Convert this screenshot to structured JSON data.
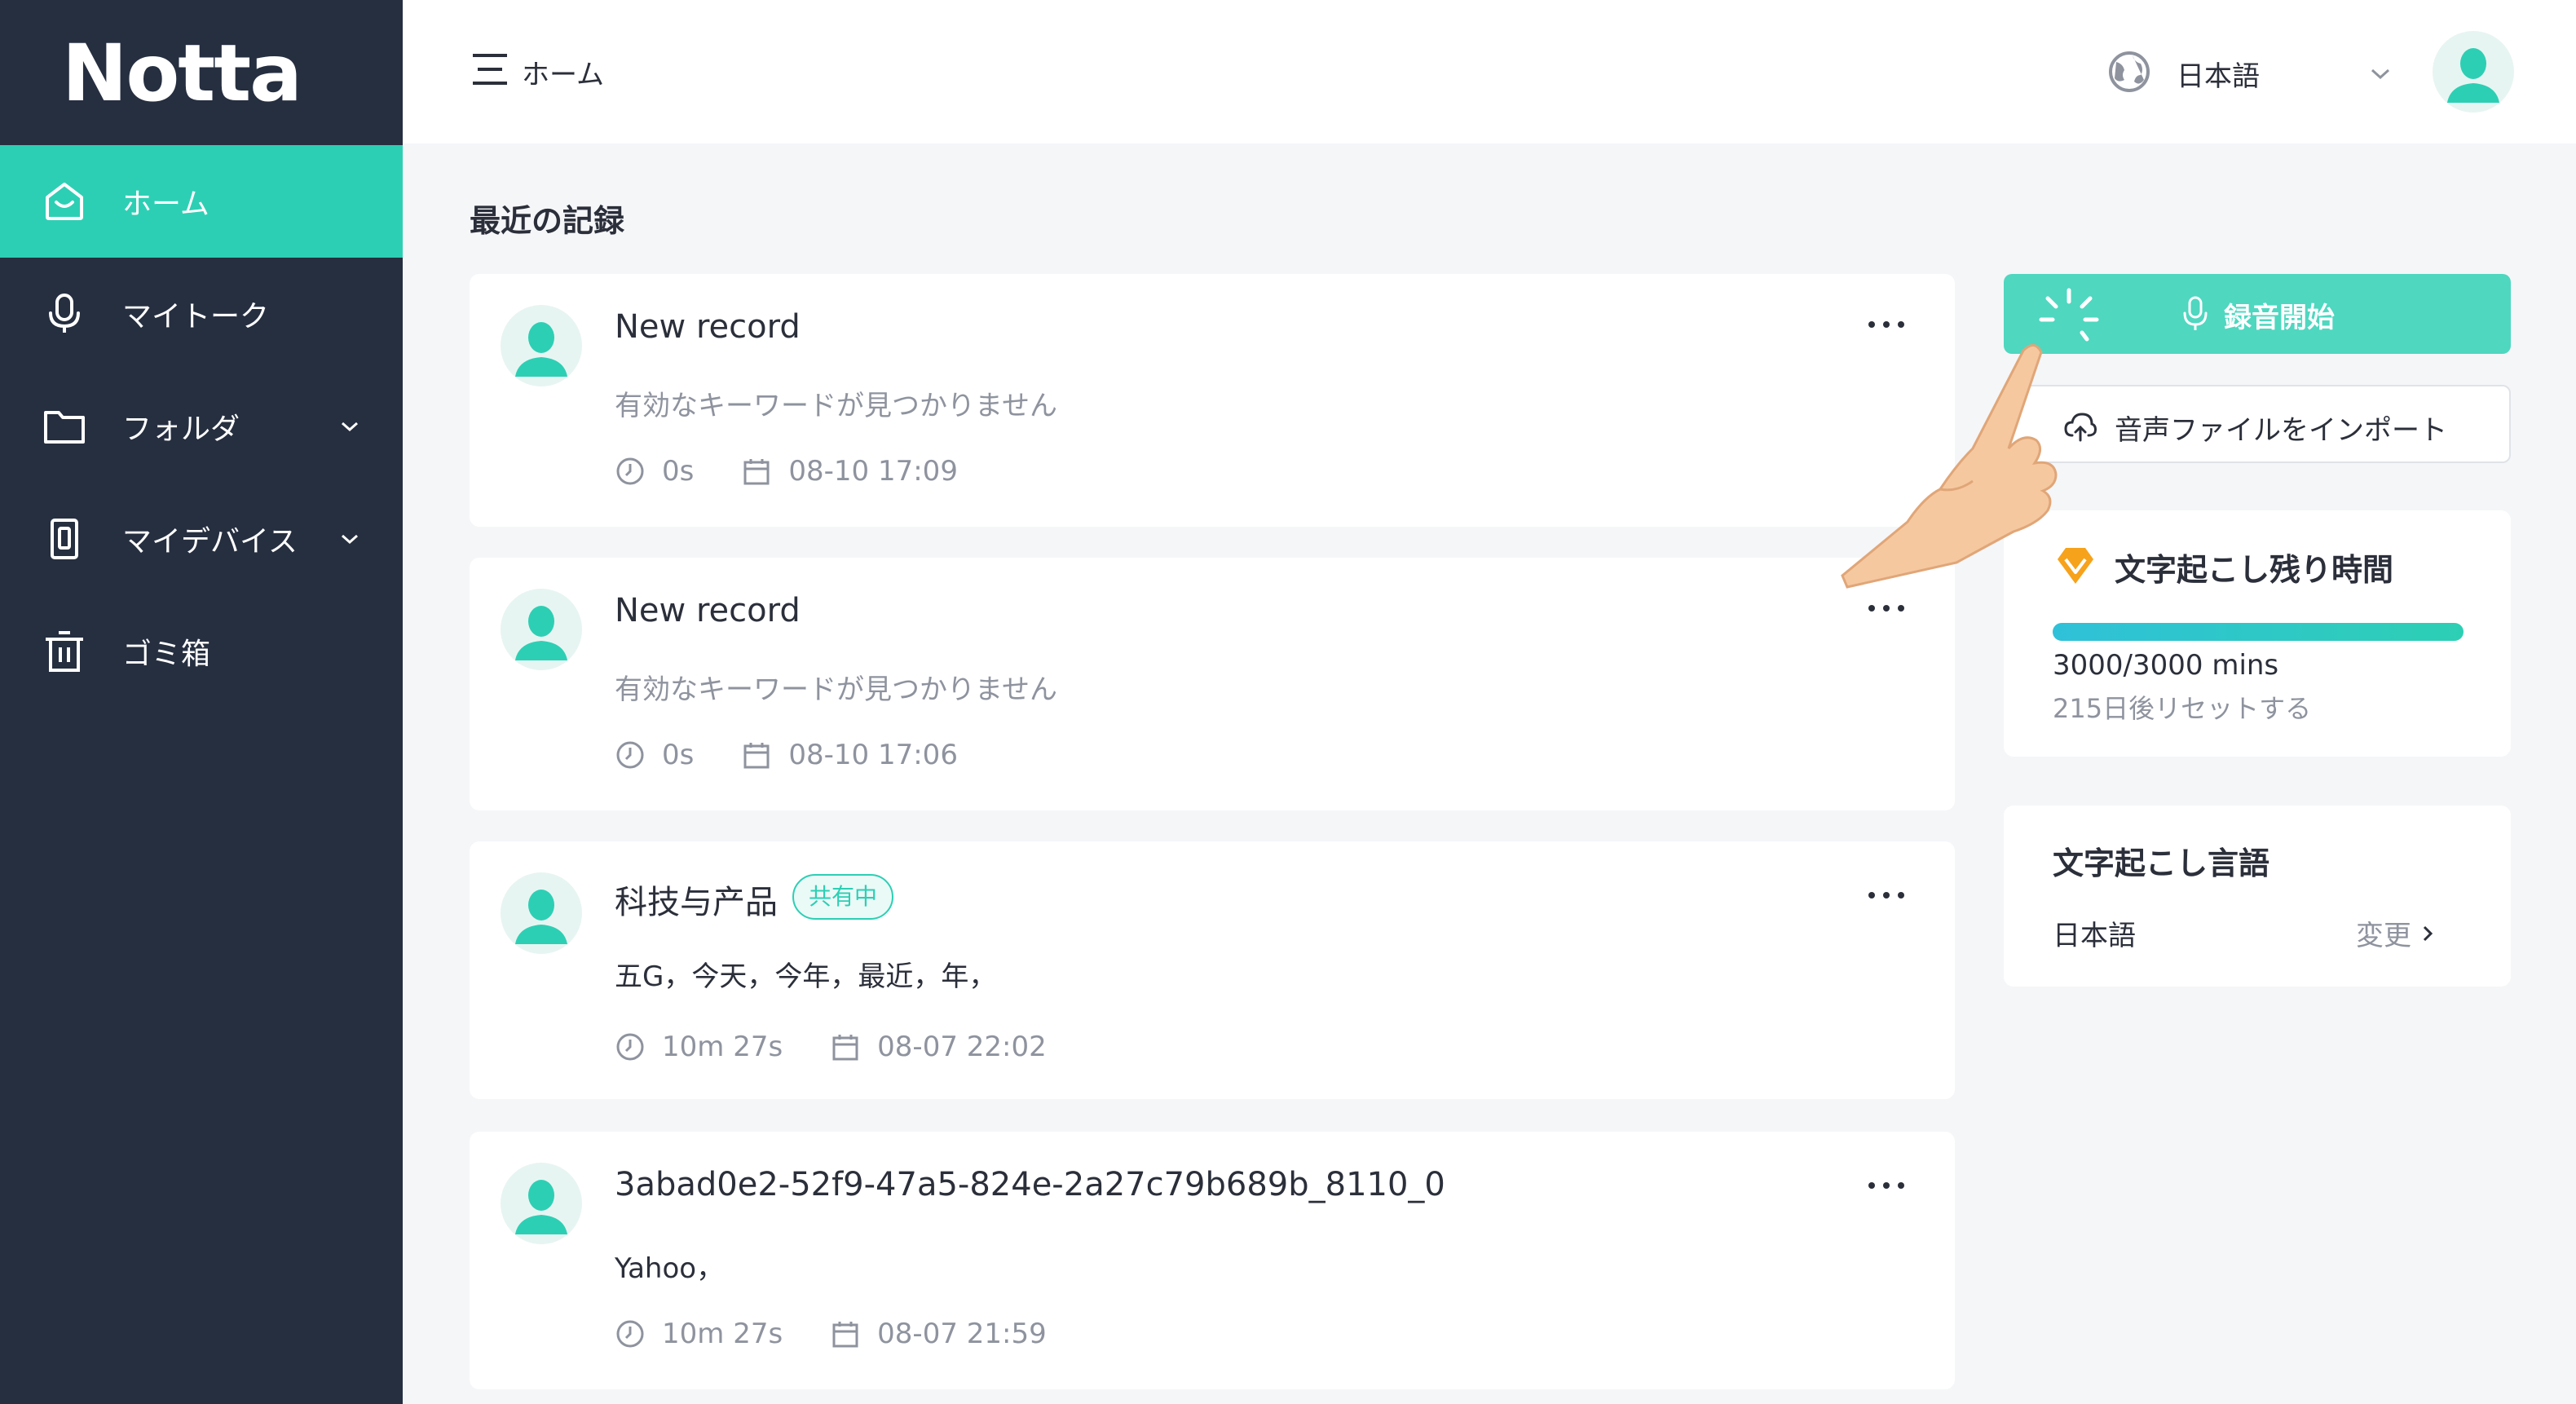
{
  "brand": {
    "logo_text": "Notta",
    "accent": "#2dcfb4",
    "sidebar_bg": "#262f40"
  },
  "sidebar": {
    "items": [
      {
        "label": "ホーム",
        "icon": "home-icon",
        "active": true
      },
      {
        "label": "マイトーク",
        "icon": "microphone-icon"
      },
      {
        "label": "フォルダ",
        "icon": "folder-icon",
        "has_dropdown": true
      },
      {
        "label": "マイデバイス",
        "icon": "device-icon",
        "has_dropdown": true
      },
      {
        "label": "ゴミ箱",
        "icon": "trash-icon"
      }
    ]
  },
  "header": {
    "title": "ホーム",
    "language": "日本語"
  },
  "main": {
    "section_title": "最近の記録",
    "records": [
      {
        "title": "New record",
        "snippet": "有効なキーワードが見つかりません",
        "duration": "0s",
        "date": "08-10 17:09"
      },
      {
        "title": "New record",
        "snippet": "有効なキーワードが見つかりません",
        "duration": "0s",
        "date": "08-10 17:06"
      },
      {
        "title": "科技与产品",
        "badge": "共有中",
        "snippet": "五G，今天，今年，最近，年，",
        "duration": "10m 27s",
        "date": "08-07 22:02"
      },
      {
        "title": "3abad0e2-52f9-47a5-824e-2a27c79b689b_8110_0",
        "snippet": "Yahoo，",
        "duration": "10m 27s",
        "date": "08-07 21:59"
      }
    ]
  },
  "right_panel": {
    "record_button": "録音開始",
    "import_button": "音声ファイルをインポート",
    "quota": {
      "title": "文字起こし残り時間",
      "value": "3000/3000 mins",
      "fraction": 1.0,
      "reset": "215日後リセットする"
    },
    "language": {
      "title": "文字起こし言語",
      "value": "日本語",
      "change": "変更"
    }
  }
}
